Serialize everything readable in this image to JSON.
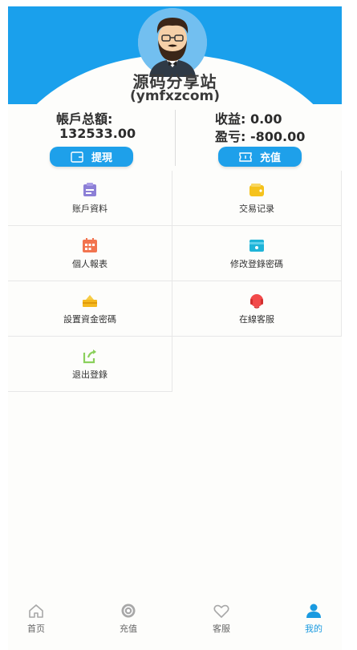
{
  "profile": {
    "site_name": "源码分享站",
    "site_url": "(ymfxzcom)"
  },
  "account": {
    "balance_label": "帳戶总額:",
    "balance_value": "132533.00",
    "income_label": "收益: 0.00",
    "profit_label": "盈亏: -800.00",
    "withdraw_button": "提現",
    "recharge_button": "充值"
  },
  "menu": [
    {
      "label": "账戶資料",
      "icon": "id-card-icon",
      "color": "#8c7fd6"
    },
    {
      "label": "交易记录",
      "icon": "wallet-icon",
      "color": "#f5c21b"
    },
    {
      "label": "個人報表",
      "icon": "calendar-icon",
      "color": "#f2744f"
    },
    {
      "label": "修改登錄密碼",
      "icon": "card-lock-icon",
      "color": "#1fb4d8"
    },
    {
      "label": "設置資金密碼",
      "icon": "money-stack-icon",
      "color": "#f4b81e"
    },
    {
      "label": "在線客服",
      "icon": "headset-icon",
      "color": "#f24a4a"
    },
    {
      "label": "退出登錄",
      "icon": "logout-icon",
      "color": "#8bd05c"
    }
  ],
  "tabs": [
    {
      "label": "首页",
      "icon": "home-icon",
      "active": false
    },
    {
      "label": "充值",
      "icon": "coin-icon",
      "active": false
    },
    {
      "label": "客服",
      "icon": "heart-icon",
      "active": false
    },
    {
      "label": "我的",
      "icon": "user-icon",
      "active": true
    }
  ],
  "colors": {
    "brand_blue": "#1aa0ec",
    "active_tab": "#1a9ae0",
    "inactive_tab": "#a8a8a8"
  }
}
